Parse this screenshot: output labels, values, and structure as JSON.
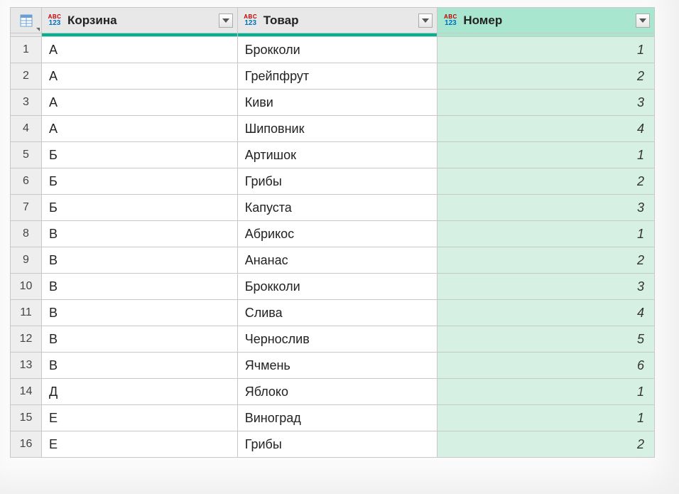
{
  "columns": [
    {
      "label": "Корзина",
      "type": "ABC123",
      "highlighted": false
    },
    {
      "label": "Товар",
      "type": "ABC123",
      "highlighted": false
    },
    {
      "label": "Номер",
      "type": "ABC123",
      "highlighted": true
    }
  ],
  "rows": [
    {
      "n": "1",
      "c0": "А",
      "c1": "Брокколи",
      "c2": "1"
    },
    {
      "n": "2",
      "c0": "А",
      "c1": "Грейпфрут",
      "c2": "2"
    },
    {
      "n": "3",
      "c0": "А",
      "c1": "Киви",
      "c2": "3"
    },
    {
      "n": "4",
      "c0": "А",
      "c1": "Шиповник",
      "c2": "4"
    },
    {
      "n": "5",
      "c0": "Б",
      "c1": "Артишок",
      "c2": "1"
    },
    {
      "n": "6",
      "c0": "Б",
      "c1": "Грибы",
      "c2": "2"
    },
    {
      "n": "7",
      "c0": "Б",
      "c1": "Капуста",
      "c2": "3"
    },
    {
      "n": "8",
      "c0": "В",
      "c1": "Абрикос",
      "c2": "1"
    },
    {
      "n": "9",
      "c0": "В",
      "c1": "Ананас",
      "c2": "2"
    },
    {
      "n": "10",
      "c0": "В",
      "c1": "Брокколи",
      "c2": "3"
    },
    {
      "n": "11",
      "c0": "В",
      "c1": "Слива",
      "c2": "4"
    },
    {
      "n": "12",
      "c0": "В",
      "c1": "Чернослив",
      "c2": "5"
    },
    {
      "n": "13",
      "c0": "В",
      "c1": "Ячмень",
      "c2": "6"
    },
    {
      "n": "14",
      "c0": "Д",
      "c1": "Яблоко",
      "c2": "1"
    },
    {
      "n": "15",
      "c0": "Е",
      "c1": "Виноград",
      "c2": "1"
    },
    {
      "n": "16",
      "c0": "Е",
      "c1": "Грибы",
      "c2": "2"
    }
  ]
}
